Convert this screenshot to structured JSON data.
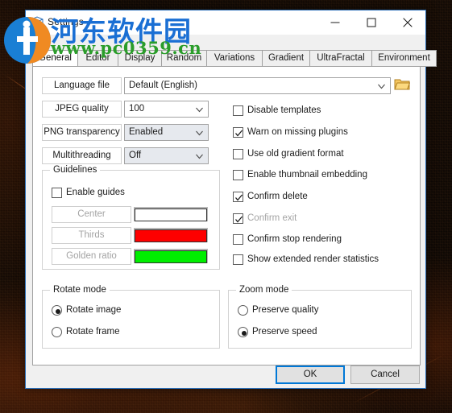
{
  "window": {
    "title": "Settings",
    "icon": "app-icon",
    "controls": [
      {
        "name": "minimize-button",
        "glyph": "minimize-icon"
      },
      {
        "name": "maximize-button",
        "glyph": "maximize-icon"
      },
      {
        "name": "close-button",
        "glyph": "close-icon"
      }
    ]
  },
  "tabs": [
    {
      "label": "General",
      "active": true
    },
    {
      "label": "Editor",
      "active": false
    },
    {
      "label": "Display",
      "active": false
    },
    {
      "label": "Random",
      "active": false
    },
    {
      "label": "Variations",
      "active": false
    },
    {
      "label": "Gradient",
      "active": false
    },
    {
      "label": "UltraFractal",
      "active": false
    },
    {
      "label": "Environment",
      "active": false
    }
  ],
  "general": {
    "fields": [
      {
        "label": "Language file",
        "value": "Default (English)",
        "style": "white",
        "has_browse": true
      },
      {
        "label": "JPEG quality",
        "value": "100",
        "style": "white",
        "has_browse": false
      },
      {
        "label": "PNG transparency",
        "value": "Enabled",
        "style": "gray",
        "has_browse": false
      },
      {
        "label": "Multithreading",
        "value": "Off",
        "style": "gray",
        "has_browse": false
      }
    ],
    "browse_icon": "folder-icon",
    "checkboxes": [
      {
        "label": "Disable templates",
        "checked": false,
        "dim": false
      },
      {
        "label": "Warn on missing plugins",
        "checked": true,
        "dim": false
      },
      {
        "label": "Use old gradient format",
        "checked": false,
        "dim": false
      },
      {
        "label": "Enable thumbnail embedding",
        "checked": false,
        "dim": false
      },
      {
        "label": "Confirm delete",
        "checked": true,
        "dim": false
      },
      {
        "label": "Confirm exit",
        "checked": true,
        "dim": true
      },
      {
        "label": "Confirm stop rendering",
        "checked": false,
        "dim": false
      },
      {
        "label": "Show extended render statistics",
        "checked": false,
        "dim": false
      }
    ],
    "guidelines": {
      "title": "Guidelines",
      "enable_label": "Enable guides",
      "enable_checked": false,
      "rows": [
        {
          "label": "Center",
          "color": "#ffffff"
        },
        {
          "label": "Thirds",
          "color": "#fe0000"
        },
        {
          "label": "Golden ratio",
          "color": "#00ee00"
        }
      ]
    },
    "rotate_mode": {
      "title": "Rotate mode",
      "options": [
        {
          "label": "Rotate image",
          "selected": true
        },
        {
          "label": "Rotate frame",
          "selected": false
        }
      ]
    },
    "zoom_mode": {
      "title": "Zoom mode",
      "options": [
        {
          "label": "Preserve quality",
          "selected": false
        },
        {
          "label": "Preserve speed",
          "selected": true
        }
      ]
    }
  },
  "footer": {
    "ok_label": "OK",
    "cancel_label": "Cancel"
  },
  "watermark": {
    "chinese": "河东软件园",
    "url": "www.pc0359.cn",
    "chinese_color": "#1a6fd4",
    "url_color": "#2a9d2a"
  }
}
